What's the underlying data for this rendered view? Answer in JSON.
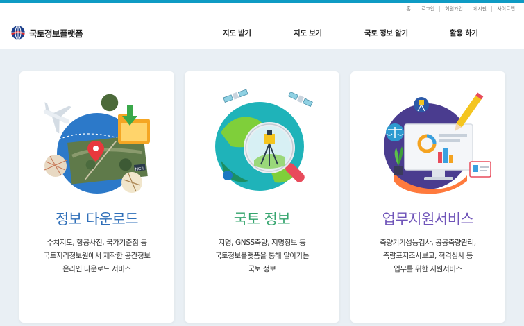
{
  "util_links": [
    "홈",
    "로그인",
    "회원가입",
    "게시판",
    "사이트맵"
  ],
  "logo": {
    "text": "국토정보플랫폼"
  },
  "nav": [
    "지도 받기",
    "지도 보기",
    "국토 정보 알기",
    "활용 하기"
  ],
  "cards": [
    {
      "title": "정보 다운로드",
      "title_color": "#2f6fb9",
      "lines": [
        "수치지도, 항공사진, 국가기준점 등",
        "국토지리정보원에서 제작한 공간정보",
        "온라인 다운로드 서비스"
      ],
      "badge": "NGII"
    },
    {
      "title": "국토 정보",
      "title_color": "#35a56e",
      "lines": [
        "지명, GNSS측량, 지명정보 등",
        "국토정보플랫폼을 통해 알아가는",
        "국토 정보"
      ]
    },
    {
      "title": "업무지원서비스",
      "title_color": "#6f54b9",
      "lines": [
        "측량기기성능검사, 공공측량관리,",
        "측량표지조사보고, 적격심사 등",
        "업무를 위한 지원서비스"
      ]
    }
  ]
}
